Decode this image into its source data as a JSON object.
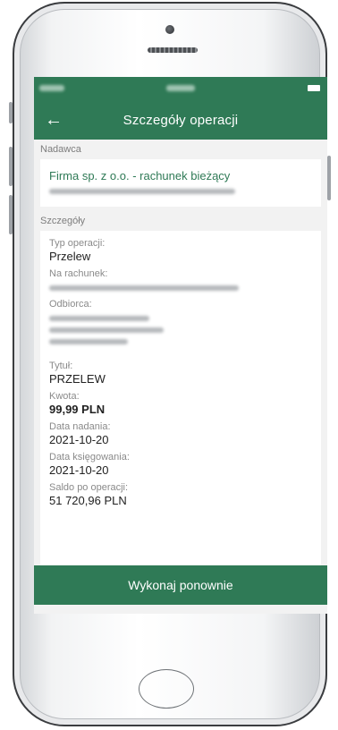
{
  "appbar": {
    "title": "Szczegóły operacji",
    "back_icon": "arrow-left-icon"
  },
  "sender": {
    "label": "Nadawca",
    "name": "Firma sp. z o.o. - rachunek bieżący"
  },
  "details": {
    "label": "Szczegóły",
    "fields": [
      {
        "label": "Typ operacji:",
        "value": "Przelew"
      },
      {
        "label": "Na rachunek:"
      },
      {
        "label": "Odbiorca:"
      },
      {
        "label": "Tytuł:",
        "value": "PRZELEW"
      },
      {
        "label": "Kwota:",
        "value": "99,99 PLN"
      },
      {
        "label": "Data nadania:",
        "value": "2021-10-20"
      },
      {
        "label": "Data księgowania:",
        "value": "2021-10-20"
      },
      {
        "label": "Saldo po operacji:",
        "value": "51 720,96 PLN"
      }
    ]
  },
  "actions": {
    "repeat_label": "Wykonaj ponownie"
  },
  "colors": {
    "brand": "#2f7a56",
    "background": "#f2f2f2"
  }
}
